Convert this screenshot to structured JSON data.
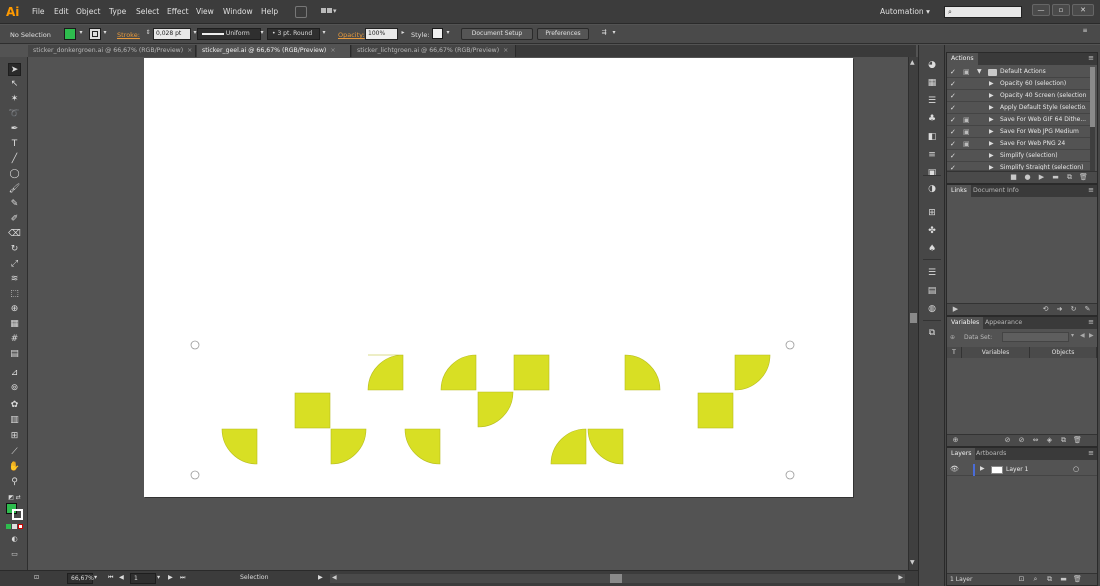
{
  "app": {
    "logo": "Ai"
  },
  "menubar": {
    "items": [
      "File",
      "Edit",
      "Object",
      "Type",
      "Select",
      "Effect",
      "View",
      "Window",
      "Help"
    ],
    "workspace": "Automation",
    "search_placeholder": ""
  },
  "controlbar": {
    "selection_status": "No Selection",
    "fill_color": "#2ebd4e",
    "stroke_label": "Stroke:",
    "stroke_weight": "0,028 pt",
    "stroke_profile": "Uniform",
    "brush": "3 pt. Round",
    "opacity_label": "Opacity:",
    "opacity_value": "100%",
    "style_label": "Style:",
    "document_setup": "Document Setup",
    "preferences": "Preferences"
  },
  "tabs": [
    {
      "label": "sticker_donkergroen.ai @ 66,67% (RGB/Preview)",
      "active": false
    },
    {
      "label": "sticker_geel.ai @ 66,67% (RGB/Preview)",
      "active": true
    },
    {
      "label": "sticker_lichtgroen.ai @ 66,67% (RGB/Preview)",
      "active": false
    }
  ],
  "artwork": {
    "shape_color": "#d8df24",
    "outline_color": "#b7bd1e"
  },
  "statusbar": {
    "zoom": "66,67%",
    "artboard_number": "1",
    "current_tool": "Selection"
  },
  "actions_panel": {
    "title": "Actions",
    "set_name": "Default Actions",
    "items": [
      "Opacity 60 (selection)",
      "Opacity 40 Screen (selection)",
      "Apply Default Style (selectio...",
      "Save For Web GIF 64 Dithe...",
      "Save For Web JPG Medium",
      "Save For Web PNG 24",
      "Simplify (selection)",
      "Simplify Straight (selection)"
    ]
  },
  "links_panel": {
    "tabs": [
      "Links",
      "Document Info"
    ]
  },
  "variables_panel": {
    "tabs": [
      "Variables",
      "Appearance"
    ],
    "dataset_label": "Data Set:",
    "columns": [
      "T",
      "Variables",
      "Objects"
    ]
  },
  "layers_panel": {
    "tabs": [
      "Layers",
      "Artboards"
    ],
    "layers": [
      {
        "name": "Layer 1",
        "color": "#4a6cd8"
      }
    ],
    "count": "1 Layer"
  },
  "icons": {
    "tools": [
      "selection-tool",
      "direct-selection-tool",
      "magic-wand-tool",
      "lasso-tool",
      "pen-tool",
      "type-tool",
      "line-tool",
      "ellipse-tool",
      "paintbrush-tool",
      "pencil-tool",
      "blob-brush-tool",
      "eraser-tool",
      "rotate-tool",
      "scale-tool",
      "warp-tool",
      "free-transform-tool",
      "shape-builder-tool",
      "perspective-grid-tool",
      "mesh-tool",
      "gradient-tool",
      "eyedropper-tool",
      "blend-tool",
      "symbol-sprayer-tool",
      "column-graph-tool",
      "artboard-tool",
      "slice-tool",
      "hand-tool",
      "zoom-tool"
    ],
    "dock": [
      "color-icon",
      "swatches-icon",
      "brushes-icon",
      "symbols-icon",
      "graphic-styles-icon",
      "stroke-icon",
      "gradient-icon",
      "transparency-icon",
      "align-icon",
      "pathfinder-icon",
      "navigator-icon",
      "info-icon",
      "transform-icon",
      "character-icon",
      "paragraph-icon",
      "opentype-icon",
      "glyphs-icon"
    ]
  }
}
